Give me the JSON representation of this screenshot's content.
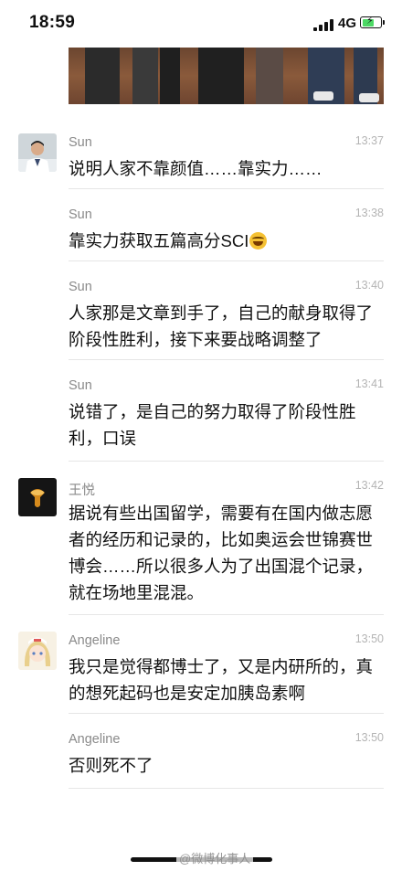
{
  "status_bar": {
    "time": "18:59",
    "network": "4G",
    "battery_icon": "battery-charging-icon",
    "signal_icon": "cellular-signal-icon"
  },
  "comments": [
    {
      "name": "Sun",
      "time": "13:37",
      "text": "说明人家不靠颜值……靠实力……",
      "avatar": "doctor-avatar"
    },
    {
      "name": "Sun",
      "time": "13:38",
      "text": "靠实力获取五篇高分SCI",
      "emoji": "tears-of-joy-emoji"
    },
    {
      "name": "Sun",
      "time": "13:40",
      "text": "人家那是文章到手了，自己的献身取得了\n阶段性胜利，接下来要战略调整了"
    },
    {
      "name": "Sun",
      "time": "13:41",
      "text": "说错了，是自己的努力取得了阶段性胜\n利，口误"
    },
    {
      "name": "王悦",
      "time": "13:42",
      "text": "据说有些出国留学，需要有在国内做志愿\n者的经历和记录的，比如奥运会世锦赛世\n博会……所以很多人为了出国混个记录，\n就在场地里混混。",
      "avatar": "dark-drop-avatar"
    },
    {
      "name": "Angeline",
      "time": "13:50",
      "text": "我只是觉得都博士了，又是内研所的，真\n的想死起码也是安定加胰岛素啊",
      "avatar": "anime-girl-avatar"
    },
    {
      "name": "Angeline",
      "time": "13:50",
      "text": "否则死不了"
    }
  ],
  "watermark": "@微博化事人",
  "colors": {
    "name": "#8a8a8a",
    "time": "#b4b4b4",
    "divider": "#e6e6e6",
    "battery": "#4cd964"
  }
}
